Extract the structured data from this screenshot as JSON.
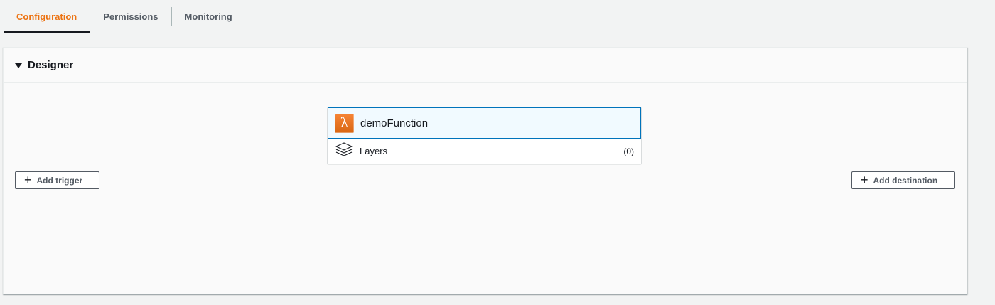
{
  "tabs": [
    {
      "label": "Configuration",
      "active": true
    },
    {
      "label": "Permissions",
      "active": false
    },
    {
      "label": "Monitoring",
      "active": false
    }
  ],
  "designer": {
    "title": "Designer",
    "function_name": "demoFunction",
    "layers_label": "Layers",
    "layers_count": "(0)",
    "add_trigger_label": "Add trigger",
    "add_destination_label": "Add destination",
    "icons": {
      "function": "lambda-icon",
      "layers": "layers-icon",
      "collapse": "caret-down-icon",
      "add": "plus-icon"
    }
  },
  "colors": {
    "accent": "#ec7211",
    "selected_border": "#0073bb",
    "selected_bg": "#f1faff",
    "lambda_orange": "#e07020"
  }
}
